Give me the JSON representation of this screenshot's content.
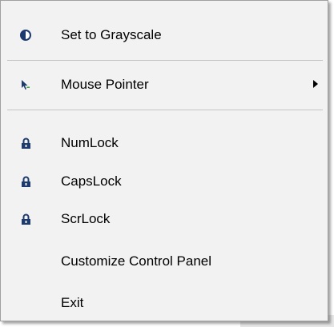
{
  "menu": {
    "items": [
      {
        "label": "Set to Grayscale",
        "icon": "contrast-icon"
      },
      {
        "label": "Mouse Pointer",
        "icon": "mouse-pointer-icon",
        "submenu": true
      },
      {
        "label": "NumLock",
        "icon": "lock-icon"
      },
      {
        "label": "CapsLock",
        "icon": "lock-icon"
      },
      {
        "label": "ScrLock",
        "icon": "lock-icon"
      },
      {
        "label": "Customize Control Panel",
        "icon": ""
      },
      {
        "label": "Exit",
        "icon": ""
      }
    ]
  },
  "colors": {
    "menu_background": "#f2f2f2",
    "icon_navy": "#1c3a6e",
    "pointer_green": "#3aa23a"
  }
}
